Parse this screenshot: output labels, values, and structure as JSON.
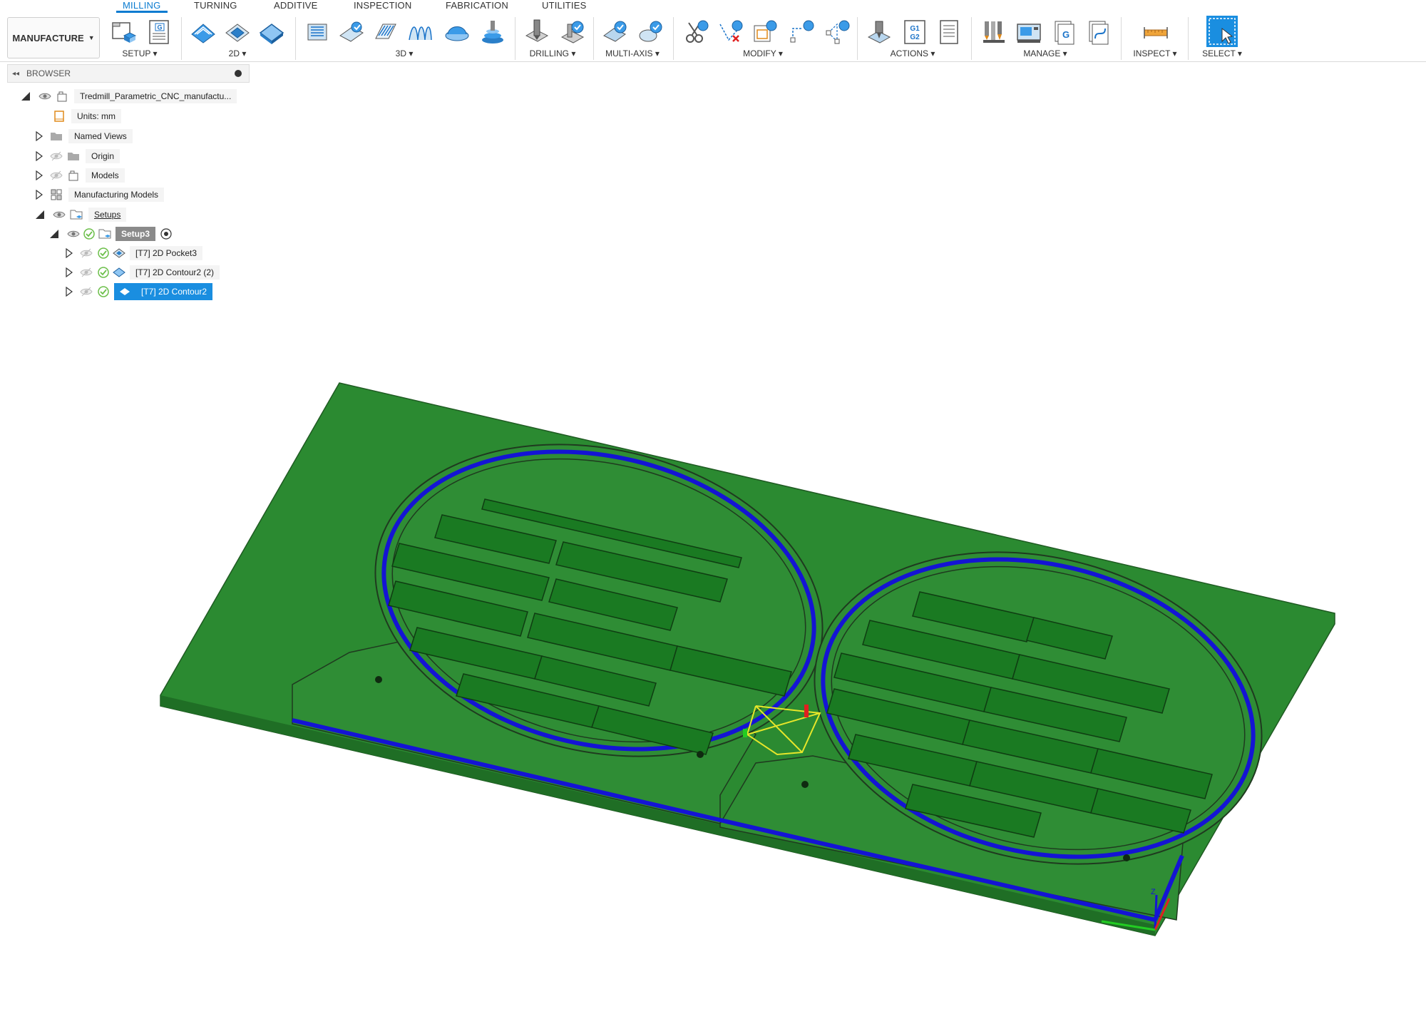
{
  "tabs": [
    {
      "label": "MILLING",
      "active": true
    },
    {
      "label": "TURNING"
    },
    {
      "label": "ADDITIVE"
    },
    {
      "label": "INSPECTION"
    },
    {
      "label": "FABRICATION"
    },
    {
      "label": "UTILITIES"
    }
  ],
  "workspace": {
    "label": "MANUFACTURE"
  },
  "groups": {
    "setup": "SETUP ▾",
    "two_d": "2D ▾",
    "three_d": "3D ▾",
    "drilling": "DRILLING ▾",
    "multi_axis": "MULTI-AXIS ▾",
    "modify": "MODIFY ▾",
    "actions": "ACTIONS ▾",
    "manage": "MANAGE ▾",
    "inspect": "INSPECT ▾",
    "select": "SELECT ▾"
  },
  "icons": {
    "g_doc": "G",
    "g1g2": "G1 G2",
    "g_post": "G"
  },
  "browser": {
    "title": "BROWSER",
    "root": "Tredmill_Parametric_CNC_manufactu...",
    "units": "Units: mm",
    "named_views": "Named Views",
    "origin": "Origin",
    "models": "Models",
    "manufacturing_models": "Manufacturing Models",
    "setups": "Setups",
    "setup3": "Setup3",
    "ops": [
      {
        "label": "[T7] 2D Pocket3"
      },
      {
        "label": "[T7] 2D Contour2 (2)"
      },
      {
        "label": "[T7] 2D Contour2",
        "selected": true
      }
    ]
  },
  "viewport": {
    "axis_label": "Z",
    "colors": {
      "stock": "#2b8a31",
      "toolpath": "#1414d4",
      "outline": "#1f3a1f",
      "selection": "#e6e62a"
    }
  }
}
